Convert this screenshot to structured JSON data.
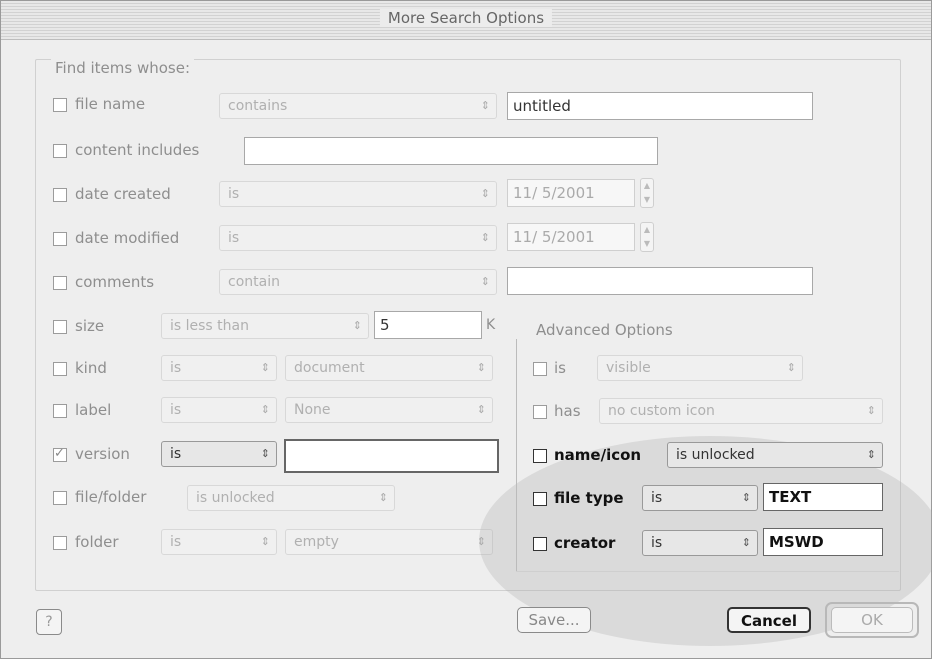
{
  "window": {
    "title": "More Search Options"
  },
  "section_heading": "Find items whose:",
  "left_rows": {
    "file_name": {
      "label": "file name",
      "op": "contains",
      "value": "untitled"
    },
    "content_includes": {
      "label": "content includes",
      "value": ""
    },
    "date_created": {
      "label": "date created",
      "op": "is",
      "date": "11/ 5/2001"
    },
    "date_modified": {
      "label": "date modified",
      "op": "is",
      "date": "11/ 5/2001"
    },
    "comments": {
      "label": "comments",
      "op": "contain",
      "value": ""
    },
    "size": {
      "label": "size",
      "op": "is less than",
      "value": "5",
      "unit": "K"
    },
    "kind": {
      "label": "kind",
      "op": "is",
      "value": "document"
    },
    "label": {
      "label": "label",
      "op": "is",
      "value": "None"
    },
    "version": {
      "label": "version",
      "op": "is",
      "value": ""
    },
    "file_folder": {
      "label": "file/folder",
      "op": "is unlocked"
    },
    "folder": {
      "label": "folder",
      "op": "is",
      "value": "empty"
    }
  },
  "advanced": {
    "heading": "Advanced Options",
    "is": {
      "label": "is",
      "value": "visible"
    },
    "has": {
      "label": "has",
      "value": "no custom icon"
    },
    "name_icon": {
      "label": "name/icon",
      "value": "is unlocked"
    },
    "file_type": {
      "label": "file type",
      "op": "is",
      "value": "TEXT"
    },
    "creator": {
      "label": "creator",
      "op": "is",
      "value": "MSWD"
    }
  },
  "buttons": {
    "help": "?",
    "save": "Save...",
    "cancel": "Cancel",
    "ok": "OK"
  }
}
